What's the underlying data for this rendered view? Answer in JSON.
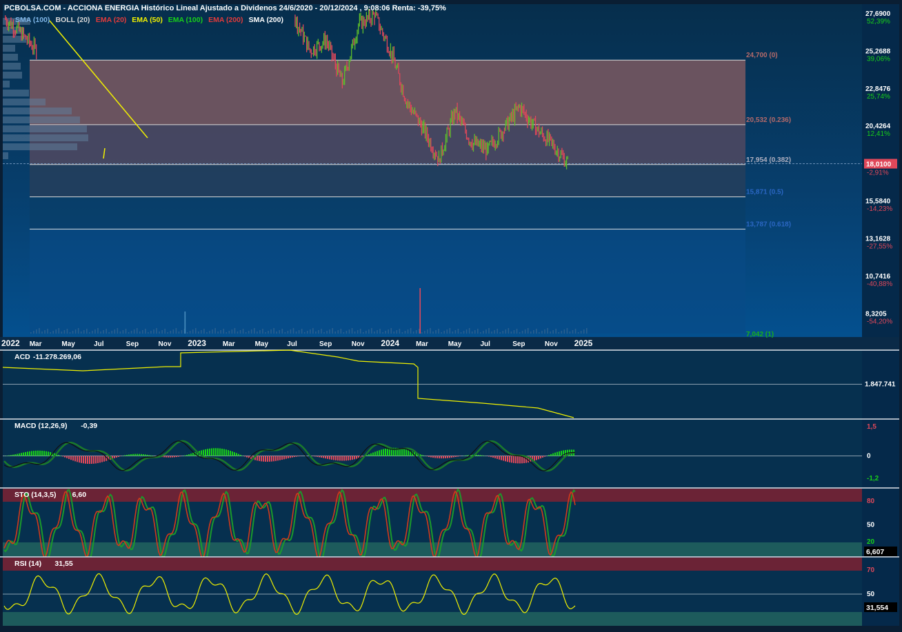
{
  "header": {
    "title": "PCBOLSA.COM - ACCIONA ENERGIA Histórico Lineal Ajustado a Dividenos 24/6/2020 - 20/12/2024 , 9:08:06 Renta: -39,75%",
    "indicators": [
      {
        "label": "SMA (100)",
        "color": "#7fb6e8"
      },
      {
        "label": "BOLL (20)",
        "color": "#d8d8d8"
      },
      {
        "label": "EMA (20)",
        "color": "#e23b3b"
      },
      {
        "label": "EMA (50)",
        "color": "#f2f200"
      },
      {
        "label": "EMA (100)",
        "color": "#19d119"
      },
      {
        "label": "EMA (200)",
        "color": "#e23b3b"
      },
      {
        "label": "SMA (200)",
        "color": "#ffffff"
      }
    ]
  },
  "colors": {
    "background": "#06304f",
    "up": "#5fbf2a",
    "down": "#e0485a",
    "current_price_bg": "#e0485a",
    "fib_zone_upper": "#735660",
    "fib_zone_mid": "#4d4860",
    "positive": "#19d119",
    "negative": "#e0485a",
    "oscillator_line": "#f2f200",
    "overbought_band": "#6b2336",
    "oversold_band": "#1d5b5c"
  },
  "price_axis": {
    "labels": [
      {
        "price": "27,6900",
        "pct": "52,39%",
        "sign": "pos"
      },
      {
        "price": "25,2688",
        "pct": "39,06%",
        "sign": "pos"
      },
      {
        "price": "22,8476",
        "pct": "25,74%",
        "sign": "pos"
      },
      {
        "price": "20,4264",
        "pct": "12,41%",
        "sign": "pos"
      },
      {
        "price": "15,5840",
        "pct": "-14,23%",
        "sign": "neg"
      },
      {
        "price": "13,1628",
        "pct": "-27,55%",
        "sign": "neg"
      },
      {
        "price": "10,7416",
        "pct": "-40,88%",
        "sign": "neg"
      },
      {
        "price": "8,3205",
        "pct": "-54,20%",
        "sign": "neg"
      }
    ],
    "current_price": "18,0100",
    "current_pct": "-2,91%"
  },
  "fibonacci": [
    {
      "label": "24,700 (0)",
      "value": 24.7,
      "color": "#b46a6a"
    },
    {
      "label": "20,532 (0.236)",
      "value": 20.532,
      "color": "#b46a6a"
    },
    {
      "label": "17,954 (0.382)",
      "value": 17.954,
      "color": "#b0b0c0"
    },
    {
      "label": "15,871 (0.5)",
      "value": 15.871,
      "color": "#2a66c2"
    },
    {
      "label": "13,787 (0.618)",
      "value": 13.787,
      "color": "#2a66c2"
    },
    {
      "label": "7,042 (1)",
      "value": 7.042,
      "color": "#19b119"
    }
  ],
  "time_axis": {
    "labels": [
      "2022",
      "Mar",
      "May",
      "Jul",
      "Sep",
      "Nov",
      "2023",
      "Mar",
      "May",
      "Jul",
      "Sep",
      "Nov",
      "2024",
      "Mar",
      "May",
      "Jul",
      "Sep",
      "Nov",
      "2025"
    ],
    "bold": [
      "2022",
      "2023",
      "2024",
      "2025"
    ]
  },
  "panels": {
    "acd": {
      "label": "ACD",
      "value": "-11.278.269,06",
      "axis_labels": [
        "1.847.741"
      ]
    },
    "macd": {
      "label": "MACD (12,26,9)",
      "value": "-0,39",
      "axis_labels": [
        {
          "text": "1,5",
          "sign": "neg"
        },
        {
          "text": "0",
          "sign": "neu"
        },
        {
          "text": "-1,2",
          "sign": "pos"
        }
      ]
    },
    "sto": {
      "label": "STO (14,3,5)",
      "value": "6,60",
      "axis_labels": [
        {
          "text": "80",
          "sign": "neg"
        },
        {
          "text": "50",
          "sign": "neu"
        },
        {
          "text": "20",
          "sign": "pos"
        }
      ],
      "current": "6,607"
    },
    "rsi": {
      "label": "RSI (14)",
      "value": "31,55",
      "axis_labels": [
        {
          "text": "70",
          "sign": "neg"
        },
        {
          "text": "50",
          "sign": "neu"
        }
      ],
      "current": "31,554"
    }
  },
  "chart_data": {
    "type": "line",
    "title": "PCBOLSA.COM - ACCIONA ENERGIA Histórico Lineal Ajustado a Dividenos 24/6/2020 - 20/12/2024 , 9:08:06 Renta: -39,75%",
    "xlabel": "",
    "ylabel": "",
    "ylim": [
      7.04,
      27.69
    ],
    "series": [
      {
        "x": [
          "2022-01",
          "2022-02",
          "2022-03",
          "2022-05",
          "2022-06",
          "2022-07",
          "2022-09",
          "2022-11",
          "2023-01",
          "2023-03",
          "2023-05",
          "2023-07",
          "2023-08",
          "2023-09",
          "2023-10",
          "2023-11",
          "2023-12",
          "2024-01",
          "2024-02",
          "2024-03",
          "2024-04",
          "2024-05",
          "2024-06",
          "2024-07",
          "2024-08",
          "2024-09",
          "2024-10",
          "2024-11",
          "2024-12"
        ],
        "values": [
          27.4,
          26.5,
          25.3,
          null,
          null,
          null,
          null,
          null,
          null,
          null,
          null,
          27.5,
          25.3,
          26.0,
          23.2,
          27.0,
          27.6,
          25.3,
          22.0,
          20.3,
          18.3,
          21.4,
          19.4,
          18.9,
          20.2,
          21.7,
          20.3,
          19.3,
          18.01
        ]
      }
    ]
  }
}
